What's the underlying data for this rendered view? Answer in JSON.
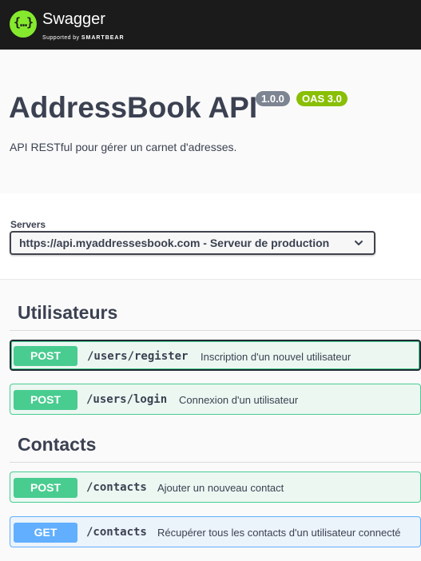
{
  "topbar": {
    "logo_icon": "swagger-logo-icon",
    "logo_glyph": "{…}",
    "brand": "Swagger",
    "brand_supported_by": "Supported by",
    "brand_company": "SMARTBEAR"
  },
  "info": {
    "title": "AddressBook API",
    "version": "1.0.0",
    "oas": "OAS 3.0",
    "description": "API RESTful pour gérer un carnet d'adresses."
  },
  "servers": {
    "label": "Servers",
    "selected": "https://api.myaddressesbook.com - Serveur de production",
    "icon": "chevron-down-icon"
  },
  "tags": [
    {
      "name": "Utilisateurs",
      "operations": [
        {
          "method": "POST",
          "path": "/users/register",
          "summary": "Inscription d'un nouvel utilisateur"
        },
        {
          "method": "POST",
          "path": "/users/login",
          "summary": "Connexion d'un utilisateur"
        }
      ]
    },
    {
      "name": "Contacts",
      "operations": [
        {
          "method": "POST",
          "path": "/contacts",
          "summary": "Ajouter un nouveau contact"
        },
        {
          "method": "GET",
          "path": "/contacts",
          "summary": "Récupérer tous les contacts d'un utilisateur connecté"
        }
      ]
    }
  ],
  "colors": {
    "topbar": "#1b1b1b",
    "logo": "#85ea2d",
    "post": "#49cc90",
    "get": "#61affe",
    "version_badge": "#7d8492",
    "oas_badge": "#89bf04"
  }
}
